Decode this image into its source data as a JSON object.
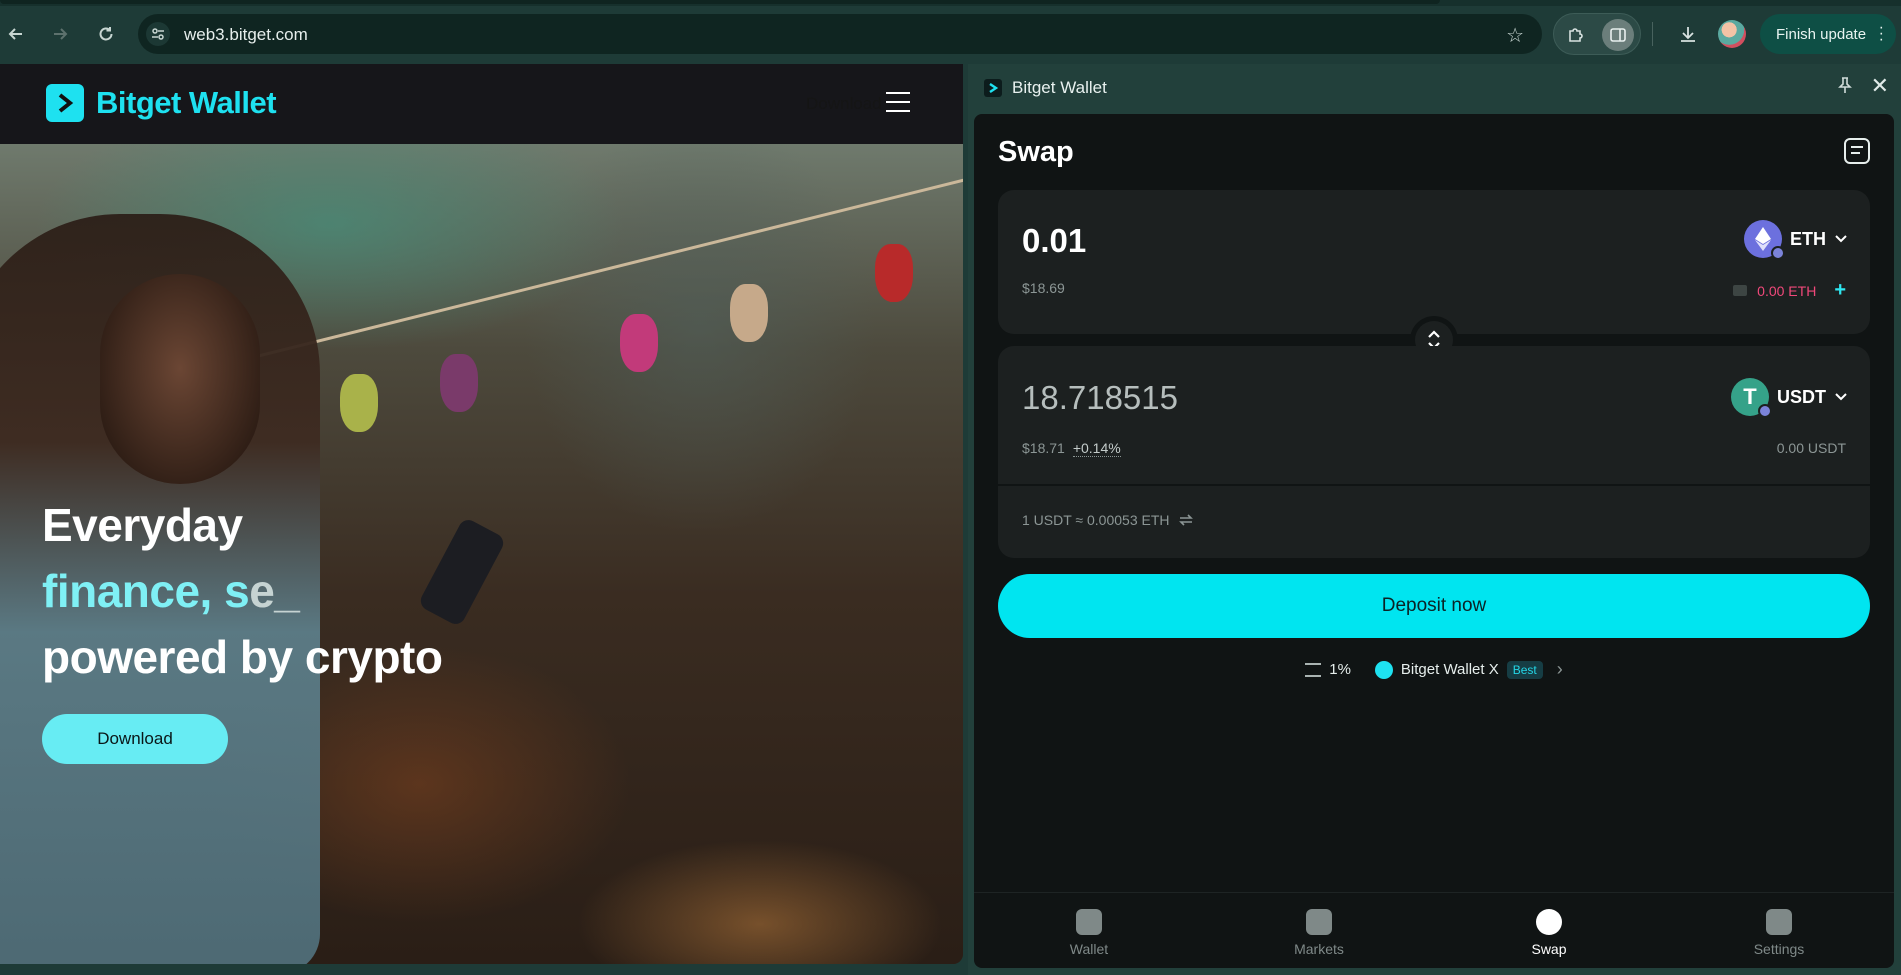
{
  "browser": {
    "url": "web3.bitget.com",
    "finish_update": "Finish update"
  },
  "site": {
    "brand": "Bitget Wallet",
    "header_download": "Download",
    "headline": {
      "line1": "Everyday",
      "line2_typed": "finance, s",
      "line2_fading": "e_",
      "line3": "powered by crypto"
    },
    "cta": "Download"
  },
  "panel": {
    "title": "Bitget Wallet",
    "swap": {
      "title": "Swap",
      "from": {
        "amount": "0.01",
        "usd": "$18.69",
        "token": "ETH",
        "balance": "0.00 ETH"
      },
      "to": {
        "amount": "18.718515",
        "usd": "$18.71",
        "price_impact": "+0.14%",
        "token": "USDT",
        "balance": "0.00 USDT"
      },
      "rate": "1 USDT ≈ 0.00053 ETH",
      "deposit": "Deposit now",
      "slippage": "1%",
      "provider": "Bitget Wallet X",
      "best_badge": "Best"
    },
    "nav": [
      "Wallet",
      "Markets",
      "Swap",
      "Settings"
    ],
    "active_nav": "Swap"
  },
  "colors": {
    "accent": "#00e5f0",
    "negative_balance": "#f0487a",
    "panel_bg": "#101414"
  }
}
